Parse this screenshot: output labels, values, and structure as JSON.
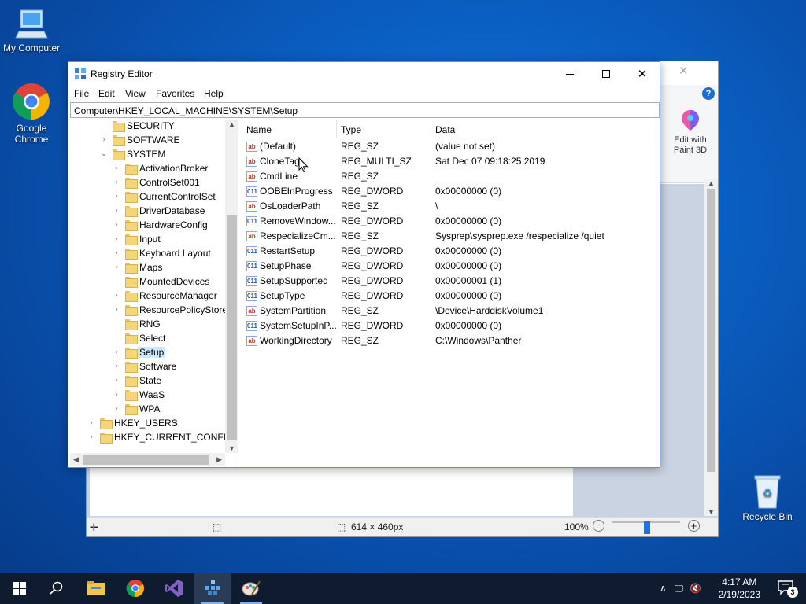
{
  "desktop": {
    "icons": [
      {
        "label": "My Computer"
      },
      {
        "label": "Google Chrome"
      },
      {
        "label": "Recycle Bin"
      }
    ]
  },
  "paint": {
    "edit_3d_label": "Edit with Paint 3D",
    "help": "?",
    "status_size": "614 × 460px",
    "zoom": "100%"
  },
  "regedit": {
    "title": "Registry Editor",
    "menu": [
      "File",
      "Edit",
      "View",
      "Favorites",
      "Help"
    ],
    "address": "Computer\\HKEY_LOCAL_MACHINE\\SYSTEM\\Setup",
    "tree": [
      {
        "label": "SECURITY",
        "expander": ""
      },
      {
        "label": "SOFTWARE",
        "expander": "›"
      },
      {
        "label": "SYSTEM",
        "expander": "⌄"
      },
      {
        "label": "ActivationBroker",
        "expander": "›"
      },
      {
        "label": "ControlSet001",
        "expander": "›"
      },
      {
        "label": "CurrentControlSet",
        "expander": "›"
      },
      {
        "label": "DriverDatabase",
        "expander": "›"
      },
      {
        "label": "HardwareConfig",
        "expander": "›"
      },
      {
        "label": "Input",
        "expander": "›"
      },
      {
        "label": "Keyboard Layout",
        "expander": "›"
      },
      {
        "label": "Maps",
        "expander": "›"
      },
      {
        "label": "MountedDevices",
        "expander": ""
      },
      {
        "label": "ResourceManager",
        "expander": "›"
      },
      {
        "label": "ResourcePolicyStore",
        "expander": "›"
      },
      {
        "label": "RNG",
        "expander": ""
      },
      {
        "label": "Select",
        "expander": ""
      },
      {
        "label": "Setup",
        "expander": "›"
      },
      {
        "label": "Software",
        "expander": "›"
      },
      {
        "label": "State",
        "expander": "›"
      },
      {
        "label": "WaaS",
        "expander": "›"
      },
      {
        "label": "WPA",
        "expander": "›"
      },
      {
        "label": "HKEY_USERS",
        "expander": "›"
      },
      {
        "label": "HKEY_CURRENT_CONFIG",
        "expander": "›"
      }
    ],
    "columns": [
      "Name",
      "Type",
      "Data"
    ],
    "values": [
      {
        "name": "(Default)",
        "type": "REG_SZ",
        "data": "(value not set)",
        "icon": "ab"
      },
      {
        "name": "CloneTag",
        "type": "REG_MULTI_SZ",
        "data": "Sat Dec 07 09:18:25 2019",
        "icon": "ab"
      },
      {
        "name": "CmdLine",
        "type": "REG_SZ",
        "data": "",
        "icon": "ab"
      },
      {
        "name": "OOBEInProgress",
        "type": "REG_DWORD",
        "data": "0x00000000 (0)",
        "icon": "011"
      },
      {
        "name": "OsLoaderPath",
        "type": "REG_SZ",
        "data": "\\",
        "icon": "ab"
      },
      {
        "name": "RemoveWindow...",
        "type": "REG_DWORD",
        "data": "0x00000000 (0)",
        "icon": "011"
      },
      {
        "name": "RespecializeCm...",
        "type": "REG_SZ",
        "data": "Sysprep\\sysprep.exe /respecialize /quiet",
        "icon": "ab"
      },
      {
        "name": "RestartSetup",
        "type": "REG_DWORD",
        "data": "0x00000000 (0)",
        "icon": "011"
      },
      {
        "name": "SetupPhase",
        "type": "REG_DWORD",
        "data": "0x00000000 (0)",
        "icon": "011"
      },
      {
        "name": "SetupSupported",
        "type": "REG_DWORD",
        "data": "0x00000001 (1)",
        "icon": "011"
      },
      {
        "name": "SetupType",
        "type": "REG_DWORD",
        "data": "0x00000000 (0)",
        "icon": "011"
      },
      {
        "name": "SystemPartition",
        "type": "REG_SZ",
        "data": "\\Device\\HarddiskVolume1",
        "icon": "ab"
      },
      {
        "name": "SystemSetupInP...",
        "type": "REG_DWORD",
        "data": "0x00000000 (0)",
        "icon": "011"
      },
      {
        "name": "WorkingDirectory",
        "type": "REG_SZ",
        "data": "C:\\Windows\\Panther",
        "icon": "ab"
      }
    ]
  },
  "taskbar": {
    "time": "4:17 AM",
    "date": "2/19/2023",
    "notifications": "3"
  }
}
